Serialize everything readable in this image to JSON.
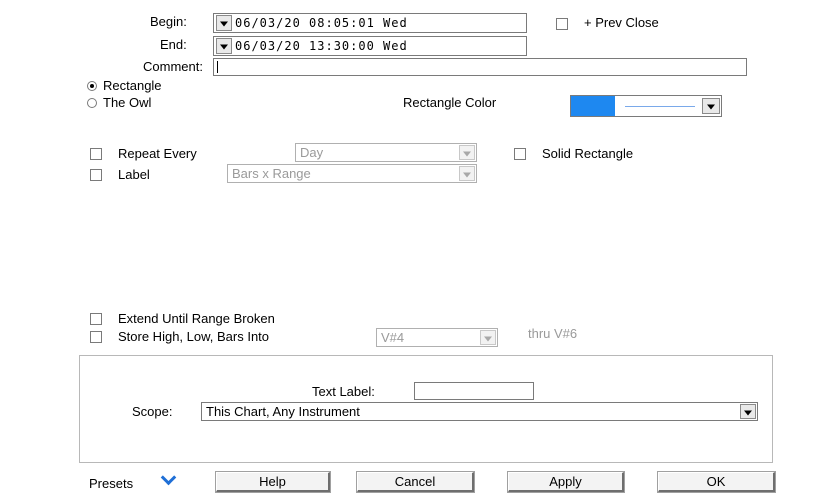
{
  "begin": {
    "label": "Begin:",
    "value": "06/03/20  08:05:01  Wed"
  },
  "end": {
    "label": "End:",
    "value": "06/03/20  13:30:00  Wed"
  },
  "prev_close": {
    "label": "+ Prev Close",
    "checked": false
  },
  "comment": {
    "label": "Comment:",
    "value": ""
  },
  "shape": {
    "options": [
      {
        "label": "Rectangle",
        "selected": true
      },
      {
        "label": "The Owl",
        "selected": false
      }
    ]
  },
  "rect_color": {
    "label": "Rectangle Color",
    "swatch": "#1e88f0",
    "line": "#7aa9ea"
  },
  "repeat": {
    "label": "Repeat Every",
    "checked": false,
    "value": "Day"
  },
  "solid": {
    "label": "Solid Rectangle",
    "checked": false
  },
  "label_opt": {
    "label": "Label",
    "checked": false,
    "value": "Bars x Range"
  },
  "extend": {
    "label": "Extend Until Range Broken",
    "checked": false
  },
  "store": {
    "label": "Store High, Low, Bars Into",
    "checked": false,
    "value": "V#4",
    "thru": "thru V#6"
  },
  "group_box": {
    "text_label": {
      "label": "Text Label:",
      "value": ""
    },
    "scope": {
      "label": "Scope:",
      "value": "This Chart, Any Instrument"
    }
  },
  "footer": {
    "presets": "Presets",
    "help": "Help",
    "cancel": "Cancel",
    "apply": "Apply",
    "ok": "OK"
  }
}
